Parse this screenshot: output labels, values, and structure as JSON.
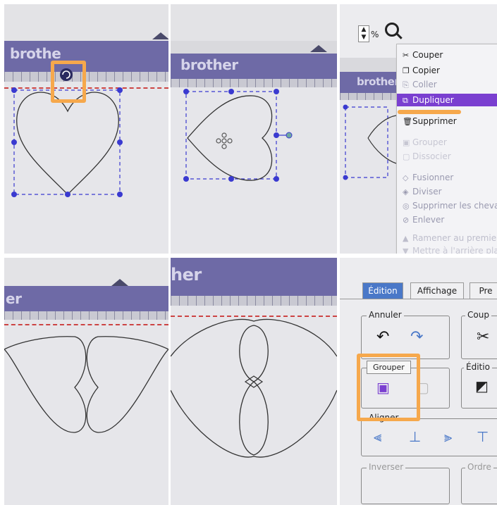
{
  "colors": {
    "accent": "#7a3fd0",
    "highlight": "#f6a84c",
    "selection": "#3a3ad0",
    "brand_bar": "#6e6aa6"
  },
  "panel1": {
    "brand": "brothe",
    "icons": [
      "rotate-icon",
      "selection-handle-icon"
    ]
  },
  "panel2": {
    "brand": "brother",
    "icons": [
      "move-icon",
      "rotate-handle-icon"
    ]
  },
  "panel3": {
    "zoom_suffix": "%",
    "brand": "brother",
    "menu": {
      "items": [
        {
          "label": "Couper",
          "icon": "scissors-icon",
          "enabled": true
        },
        {
          "label": "Copier",
          "icon": "copy-icon",
          "enabled": true
        },
        {
          "label": "Coller",
          "icon": "paste-icon",
          "enabled": false
        },
        {
          "label": "Dupliquer",
          "icon": "duplicate-icon",
          "enabled": true,
          "highlighted": true
        },
        {
          "label": "Supprimer",
          "icon": "trash-icon",
          "enabled": true
        },
        {
          "label": "Grouper",
          "icon": "group-icon",
          "enabled": false
        },
        {
          "label": "Dissocier",
          "icon": "ungroup-icon",
          "enabled": false
        },
        {
          "label": "Fusionner",
          "icon": "merge-icon",
          "enabled": false
        },
        {
          "label": "Diviser",
          "icon": "divide-icon",
          "enabled": false
        },
        {
          "label": "Supprimer les chevau",
          "icon": "overlap-icon",
          "enabled": false
        },
        {
          "label": "Enlever",
          "icon": "remove-icon",
          "enabled": false
        },
        {
          "label": "Ramener au premier",
          "icon": "front-icon",
          "enabled": false
        },
        {
          "label": "Mettre à l'arrière plan",
          "icon": "back-icon",
          "enabled": false
        }
      ]
    }
  },
  "panel4": {
    "brand": "er"
  },
  "panel5": {
    "brand": "her"
  },
  "panel6": {
    "tabs": [
      "Édition",
      "Affichage",
      "Pre"
    ],
    "groups": {
      "annuler": "Annuler",
      "couper": "Coup",
      "edition": "Éditio",
      "aligner": "Aligner",
      "inverser": "Inverser",
      "ordre": "Ordre"
    },
    "tooltip": "Grouper",
    "icons": [
      "undo-icon",
      "redo-icon",
      "scissors-icon",
      "group-icon",
      "edit-points-icon",
      "align-left-icon",
      "align-center-icon",
      "align-right-icon",
      "align-top-icon"
    ]
  }
}
